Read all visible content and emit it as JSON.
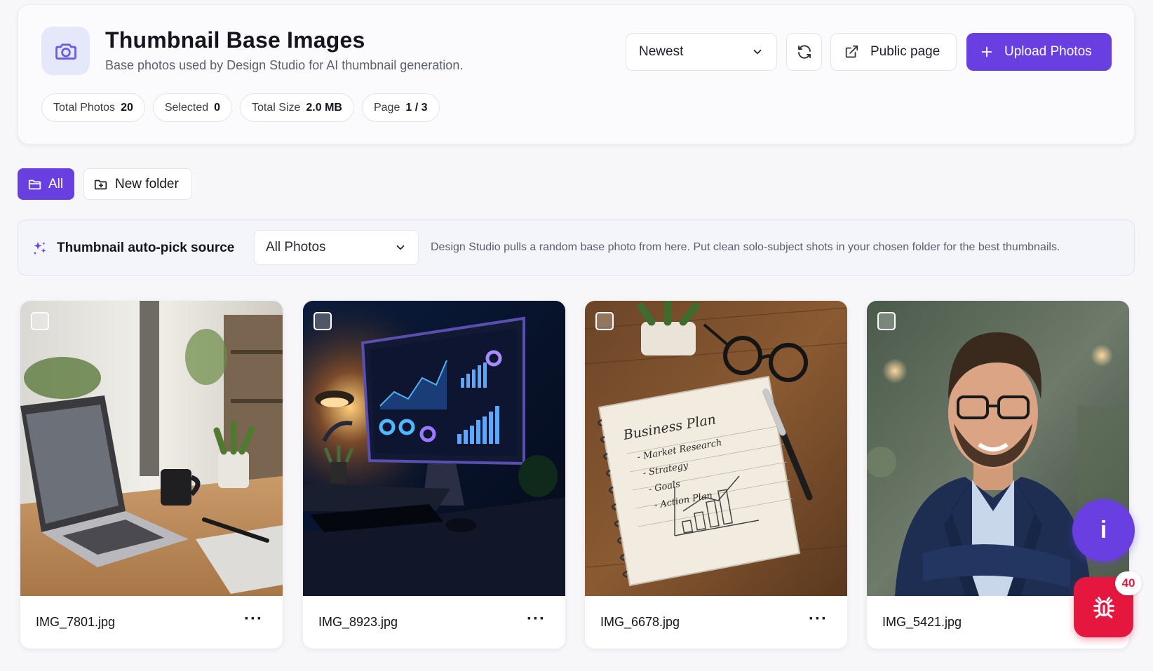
{
  "header": {
    "title": "Thumbnail Base Images",
    "subtitle": "Base photos used by Design Studio for AI thumbnail generation.",
    "icon": "camera-icon",
    "stats": [
      {
        "label": "Total Photos",
        "value": "20"
      },
      {
        "label": "Selected",
        "value": "0"
      },
      {
        "label": "Total Size",
        "value": "2.0 MB"
      },
      {
        "label": "Page",
        "value": "1 / 3"
      }
    ]
  },
  "toolbar": {
    "sort_value": "Newest",
    "public_label": "Public page",
    "upload_label": "Upload Photos"
  },
  "folders": {
    "all_label": "All",
    "new_label": "New folder"
  },
  "auto_pick": {
    "label": "Thumbnail auto-pick source",
    "select_value": "All Photos",
    "description": "Design Studio pulls a random base photo from here. Put clean solo-subject shots in your chosen folder for the best thumbnails."
  },
  "photos": [
    {
      "filename": "IMG_7801.jpg",
      "subject": "laptop on wooden desk with coffee mug"
    },
    {
      "filename": "IMG_8923.jpg",
      "subject": "monitor showing analytics dashboard in dark room"
    },
    {
      "filename": "IMG_6678.jpg",
      "subject": "notebook with business plan and pen"
    },
    {
      "filename": "IMG_5421.jpg",
      "subject": "smiling man in navy suit with glasses"
    }
  ],
  "notebook_text": {
    "heading": "Business Plan",
    "lines": [
      "- Market Research",
      "- Strategy",
      "- Goals",
      "- Action Plan"
    ]
  },
  "more_label": "···",
  "fab": {
    "info_label": "i",
    "bug_count": "40"
  },
  "colors": {
    "accent": "#6a3fe2",
    "danger": "#e5173f"
  }
}
